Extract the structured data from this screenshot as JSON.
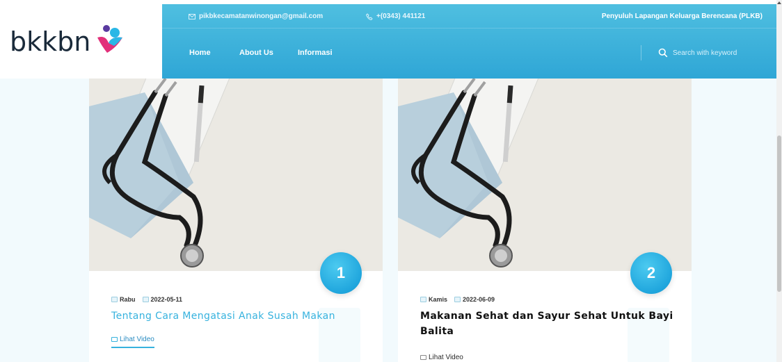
{
  "header": {
    "email": "pikbkecamatanwinongan@gmail.com",
    "phone": "+(0343) 441121",
    "role": "Penyuluh Lapangan Keluarga Berencana (PLKB)",
    "logo_text": "bkkbn",
    "nav": [
      {
        "label": "Home"
      },
      {
        "label": "About Us"
      },
      {
        "label": "Informasi"
      }
    ],
    "search": {
      "placeholder": "Search with keyword",
      "icon": "search-icon"
    }
  },
  "colors": {
    "header_primary": "#2fa6d6",
    "accent": "#36b2de",
    "badge": "#20a6dd",
    "logo_purple": "#5a3aa0",
    "logo_cyan": "#2ab7e6",
    "logo_pink": "#e2307a"
  },
  "cards": [
    {
      "number": "1",
      "day": "Rabu",
      "date": "2022-05-11",
      "title": "Tentang Cara Mengatasi Anak Susah Makan",
      "link": "Lihat Video",
      "image": "stethoscope-clipboard-photo"
    },
    {
      "number": "2",
      "day": "Kamis",
      "date": "2022-06-09",
      "title": "Makanan Sehat dan Sayur Sehat Untuk Bayi Balita",
      "link": "Lihat Video",
      "image": "stethoscope-clipboard-photo"
    }
  ]
}
